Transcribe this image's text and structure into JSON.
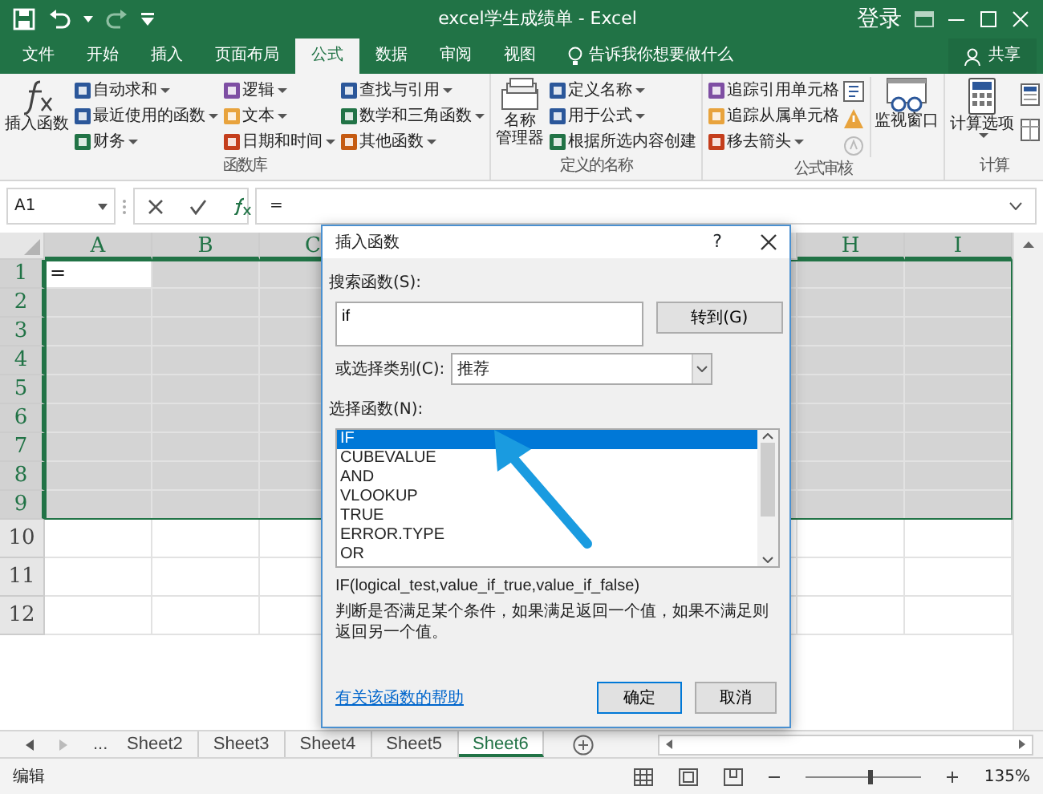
{
  "title_bar": {
    "title": "excel学生成绩单  -  Excel",
    "sign_in": "登录"
  },
  "tabs": [
    {
      "label": "文件",
      "selected": false
    },
    {
      "label": "开始",
      "selected": false
    },
    {
      "label": "插入",
      "selected": false
    },
    {
      "label": "页面布局",
      "selected": false
    },
    {
      "label": "公式",
      "selected": true
    },
    {
      "label": "数据",
      "selected": false
    },
    {
      "label": "审阅",
      "selected": false
    },
    {
      "label": "视图",
      "selected": false
    }
  ],
  "tell_me": "告诉我你想要做什么",
  "share": "共享",
  "ribbon": [
    {
      "kind": "functions",
      "label": "函数库",
      "large": [
        {
          "lines": [
            "插入函数"
          ],
          "dropdown": false
        }
      ],
      "columns": [
        [
          {
            "label": "自动求和",
            "dropdown": true
          },
          {
            "label": "最近使用的函数",
            "dropdown": true
          },
          {
            "label": "财务",
            "dropdown": true
          }
        ],
        [
          {
            "label": "逻辑",
            "dropdown": true
          },
          {
            "label": "文本",
            "dropdown": true
          },
          {
            "label": "日期和时间",
            "dropdown": true
          }
        ],
        [
          {
            "label": "查找与引用",
            "dropdown": true
          },
          {
            "label": "数学和三角函数",
            "dropdown": true
          },
          {
            "label": "其他函数",
            "dropdown": true
          }
        ]
      ]
    },
    {
      "kind": "names",
      "label": "定义的名称",
      "large": [
        {
          "lines": [
            "名称",
            "管理器"
          ],
          "dropdown": false
        }
      ],
      "columns": [
        [
          {
            "label": "定义名称",
            "dropdown": true
          },
          {
            "label": "用于公式",
            "dropdown": true
          },
          {
            "label": "根据所选内容创建",
            "dropdown": false
          }
        ]
      ]
    },
    {
      "kind": "audit",
      "label": "公式审核",
      "columns": [
        [
          {
            "label": "追踪引用单元格",
            "dropdown": false
          },
          {
            "label": "追踪从属单元格",
            "dropdown": false
          },
          {
            "label": "移去箭头",
            "dropdown": true
          }
        ]
      ],
      "large": [
        {
          "lines": [
            "监视窗口"
          ],
          "dropdown": false
        }
      ]
    },
    {
      "kind": "calc",
      "label": "计算",
      "large": [
        {
          "lines": [
            "计算选项"
          ],
          "dropdown": true
        }
      ]
    }
  ],
  "name_box": "A1",
  "formula": "=",
  "grid": {
    "columns": [
      {
        "label": "A",
        "selected": true
      },
      {
        "label": "B",
        "selected": true
      },
      {
        "label": "C",
        "selected": true
      },
      {
        "label": "H",
        "selected": true
      },
      {
        "label": "I",
        "selected": true
      }
    ],
    "rows": [
      {
        "label": "1",
        "selected": true,
        "values": [
          "="
        ]
      },
      {
        "label": "2",
        "selected": true
      },
      {
        "label": "3",
        "selected": true
      },
      {
        "label": "4",
        "selected": true
      },
      {
        "label": "5",
        "selected": true
      },
      {
        "label": "6",
        "selected": true
      },
      {
        "label": "7",
        "selected": true
      },
      {
        "label": "8",
        "selected": true
      },
      {
        "label": "9",
        "selected": true
      },
      {
        "label": "10",
        "selected": false
      },
      {
        "label": "11",
        "selected": false
      },
      {
        "label": "12",
        "selected": false
      }
    ]
  },
  "dialog": {
    "title": "插入函数",
    "help": "?",
    "search_label": "搜索函数(S):",
    "search_value": "if",
    "go_button": "转到(G)",
    "category_label": "或选择类别(C):",
    "category_value": "推荐",
    "list_label": "选择函数(N):",
    "functions": [
      {
        "name": "IF",
        "selected": true
      },
      {
        "name": "CUBEVALUE",
        "selected": false
      },
      {
        "name": "AND",
        "selected": false
      },
      {
        "name": "VLOOKUP",
        "selected": false
      },
      {
        "name": "TRUE",
        "selected": false
      },
      {
        "name": "ERROR.TYPE",
        "selected": false
      },
      {
        "name": "OR",
        "selected": false
      }
    ],
    "signature": "IF(logical_test,value_if_true,value_if_false)",
    "description": "判断是否满足某个条件，如果满足返回一个值，如果不满足则返回另一个值。",
    "help_link": "有关该函数的帮助",
    "ok": "确定",
    "cancel": "取消"
  },
  "sheet_nav": "...",
  "sheets": [
    {
      "label": "Sheet2",
      "selected": false
    },
    {
      "label": "Sheet3",
      "selected": false
    },
    {
      "label": "Sheet4",
      "selected": false
    },
    {
      "label": "Sheet5",
      "selected": false
    },
    {
      "label": "Sheet6",
      "selected": true
    }
  ],
  "status": {
    "mode": "编辑",
    "zoom": {
      "level": 0.56
    },
    "zoom_text": "135%"
  }
}
